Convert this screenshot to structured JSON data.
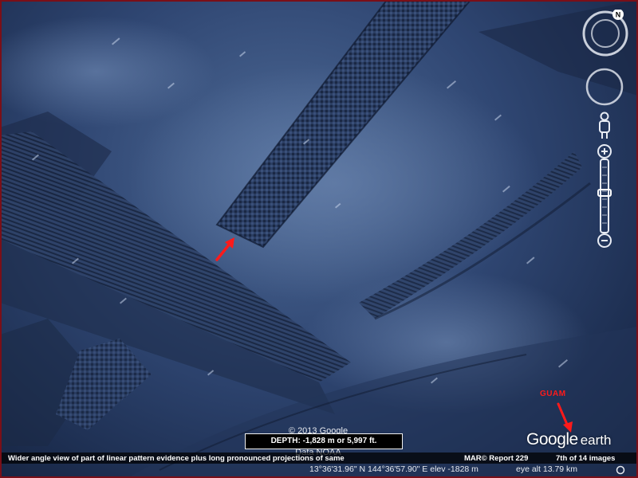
{
  "map": {
    "copyright": "© 2013 Google",
    "data_credit": "Data NOAA",
    "depth_label": "DEPTH: -1,828 m or 5,997 ft.",
    "guam_label": "GUAM",
    "logo": "Google earth",
    "logo_word1": "Google",
    "logo_word2": "earth"
  },
  "caption": {
    "text": "Wider angle view of part of linear pattern evidence plus long pronounced projections of same",
    "report": "MAR© Report 229",
    "count": "7th of 14 images"
  },
  "status": {
    "coordinates": "13°36'31.96\" N  144°36'57.90\" E  elev -1828 m",
    "eye_alt": "eye alt  13.79 km"
  },
  "navigation": {
    "north_label": "N"
  },
  "colors": {
    "annotation_red": "#ff1a1a",
    "frame_border": "#7a0f18",
    "ocean_floor": "#2f4672"
  },
  "icons": [
    "compass-icon",
    "look-ring-icon",
    "street-view-person-icon",
    "zoom-slider-icon",
    "streaming-status-icon",
    "arrow-icon"
  ]
}
